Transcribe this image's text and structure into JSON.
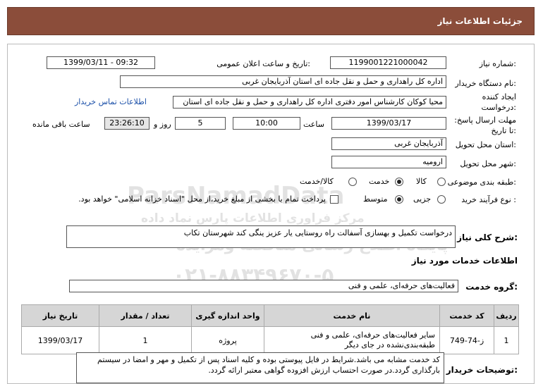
{
  "header": {
    "title": "جزئیات اطلاعات نیاز"
  },
  "fields": {
    "need_number_label": "شماره نیاز:",
    "need_number": "1199001221000042",
    "announce_label": "تاریخ و ساعت اعلان عمومی:",
    "announce_value": "1399/03/11 - 09:32",
    "buyer_label": "نام دستگاه خریدار:",
    "buyer_value": "اداره کل راهداری و حمل و نقل جاده ای استان آذربایجان غربی",
    "creator_label": "ایجاد کننده درخواست:",
    "creator_value": "محیا کوکان کارشناس امور دفتری اداره کل راهداری و حمل و نقل جاده ای استان",
    "contact_link": "اطلاعات تماس خریدار",
    "deadline_label": "مهلت ارسال پاسخ: تا تاریخ:",
    "deadline_date": "1399/03/17",
    "time_label": "ساعت",
    "deadline_time": "10:00",
    "days_value": "5",
    "days_label": "روز و",
    "remaining_time": "23:26:10",
    "remaining_label": "ساعت باقی مانده",
    "province_label": "استان محل تحویل:",
    "province_value": "آذربایجان غربی",
    "city_label": "شهر محل تحویل:",
    "city_value": "ارومیه",
    "category_label": "طبقه بندی موضوعی:",
    "category_options": [
      "کالا",
      "خدمت",
      "کالا/خدمت"
    ],
    "category_selected": "خدمت",
    "process_label": "نوع فرآیند خرید :",
    "process_options": [
      "جزیی",
      "متوسط"
    ],
    "process_selected": "متوسط",
    "process_note": "پرداخت تمام یا بخشی از مبلغ خرید،از محل \"اسناد خزانه اسلامی\" خواهد بود.",
    "summary_label": "شرح کلی نیاز:",
    "summary_value": "درخواست تکمیل و بهسازی آسفالت راه روستایی یار عزیز ینگی کند شهرستان تکاب",
    "services_title": "اطلاعات خدمات مورد نیاز",
    "service_group_label": "گروه خدمت:",
    "service_group_value": "فعالیت‌های حرفه‌ای، علمی و فنی",
    "buyer_notes_label": "توضیحات خریدار:",
    "buyer_notes": "کد خدمت مشابه می باشد.شرایط در فایل پیوستی بوده و کلیه اسناد پس از تکمیل و مهر و امضا در سیستم بارگذاری گردد.در صورت احتساب ارزش افزوده گواهی معتبر ارائه گردد."
  },
  "table": {
    "headers": [
      "ردیف",
      "کد خدمت",
      "نام خدمت",
      "واحد اندازه گیری",
      "تعداد / مقدار",
      "تاریخ نیاز"
    ],
    "rows": [
      [
        "1",
        "ز-74-749",
        "سایر فعالیت‌های حرفه‌ای، علمی و فنی طبقه‌بندی‌نشده در جای دیگر",
        "پروژه",
        "1",
        "1399/03/17"
      ]
    ]
  },
  "watermark": {
    "brand": "ParsNamadData",
    "line1": "مرکز فراوری اطلاعات پارس نماد داده",
    "line2": "پایگاه اطلاع رسانی مناقصه ومزایده",
    "phone": "۰۲۱-۸۸۳۴۹۶۷۰-۵"
  },
  "colors": {
    "header_bg": "#8b4d3a",
    "link": "#1a4fa8"
  }
}
